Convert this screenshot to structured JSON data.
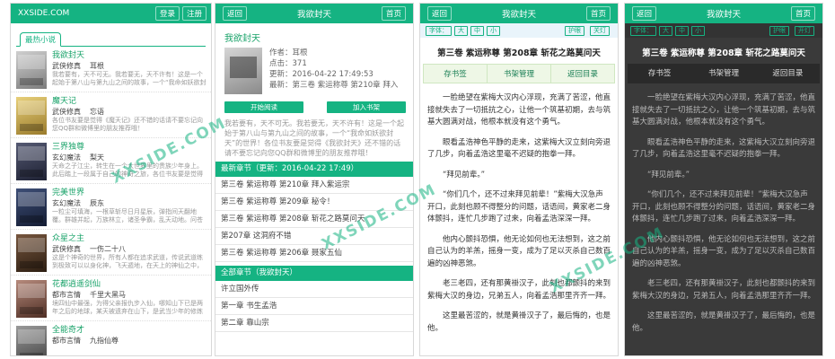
{
  "colors": {
    "accent": "#15b382",
    "link": "#1aa36a",
    "night_bg": "#3a3a3a"
  },
  "list_page": {
    "logo": "XXSIDE.COM",
    "login": "登录",
    "register": "注册",
    "section_tab": "最热小说",
    "books": [
      {
        "name": "我欲封天",
        "genre": "武侠修真",
        "author": "耳根",
        "desc": "我若要有，天不可无。我若要无，天不许有！这是一个起始于第八山与第九山之间的故事，一个“我命如妖欲封",
        "cover": [
          "#cfcfcf",
          "#7d7d7d"
        ]
      },
      {
        "name": "魔天记",
        "genre": "武侠修真",
        "author": "忘语",
        "desc": "各位书友要是觉得《魔天记》还不错的话请不要忘记向您QQ群和微博里的朋友推荐哦！",
        "cover": [
          "#e8d07a",
          "#9a7b2c"
        ]
      },
      {
        "name": "三界独尊",
        "genre": "玄幻魔法",
        "author": "梨天",
        "desc": "天命之子江尘，转生在一个大世界里的贵族少年身上。此后踏上一段属于自己的神奇之旅，各位书友要是觉得",
        "cover": [
          "#555a73",
          "#1e2133"
        ]
      },
      {
        "name": "完美世界",
        "genre": "玄幻魔法",
        "author": "辰东",
        "desc": "一粒尘可填海，一根草斩尽日月星辰，弹指间天翻地覆。群雄并起，万族林立，诸圣争霸，乱天动地。问苍茫大",
        "cover": [
          "#3e4f77",
          "#141c33"
        ]
      },
      {
        "name": "众星之主",
        "genre": "武侠修真",
        "author": "一伤二十八",
        "desc": "这是个神奇的世界，所有人都在追求武道，传说武道练到极致可以以身化神，飞天遁地，在天上的神仙之中，甚至",
        "cover": [
          "#77563e",
          "#2c1e12"
        ]
      },
      {
        "name": "花都逍遥剑仙",
        "genre": "都市言情",
        "author": "千里大黑马",
        "desc": "境四仙中最强，为得父亲报仇步入仙，哪知山下已是两年之后的地球，某天被遗弃在山下，是武当少年的修炼之路",
        "cover": [
          "#b68a7c",
          "#4f2f25"
        ]
      },
      {
        "name": "全能奇才",
        "genre": "都市言情",
        "author": "九指仙尊",
        "desc": "",
        "cover": [
          "#9a9a9a",
          "#444444"
        ]
      }
    ]
  },
  "detail_page": {
    "back": "返回",
    "title": "我欲封天",
    "home": "首页",
    "book_name": "我欲封天",
    "author": "作者：耳根",
    "clicks": "点击：371",
    "updated": "更新：2016-04-22 17:49:53",
    "latest_link": "最新：第三卷 紫运称尊 第210章 拜入",
    "read_button": "开始阅读",
    "shelf_button": "加入书架",
    "description": "我若要有，天不可无。我若要无，天不许有！这是一个起始于第八山与第九山之间的故事，一个“我命如妖欲封天”的世界！各位书友要是觉得《我欲封天》还不错的话请不要忘记向您QQ群和微博里的朋友推荐哦！",
    "latest_header": "最新章节（更新：2016-04-22 17:49）",
    "latest_chapters": [
      "第三卷 紫运称尊 第210章 拜入紫运宗",
      "第三卷 紫运称尊 第209章 秘令！",
      "第三卷 紫运称尊 第208章 斩花之路莫问天",
      "第207章 这洞府不错",
      "第三卷 紫运称尊 第206章 聂家五仙"
    ],
    "all_header": "全部章节（我欲封天）",
    "all_chapters": [
      "许立国外传",
      "第一章 书生孟浩",
      "第二章 靠山宗"
    ]
  },
  "reader_pages": [
    {
      "theme": "day",
      "back": "返回",
      "title": "我欲封天",
      "home": "首页",
      "font_label": "字体：",
      "font_large": "大",
      "font_medium": "中",
      "font_small": "小",
      "eye_mode": "护眼",
      "light_toggle": "关灯",
      "chapter_title": "第三卷 紫运称尊 第208章 斩花之路莫问天",
      "bookmark": "存书签",
      "manage": "书架管理",
      "toc": "返回目录",
      "paragraphs": [
        "一脸绝望在紫梅大汉内心浮现，充满了苦涩，他直接就失去了一切抵抗之心，让他一个筑基初期，去与筑基大圆满对战，他根本就没有这个勇气。",
        "眼看孟浩神色平静的走来，这紫梅大汉立刻向旁退了几步，向着孟浩这里毫不迟疑的抱拳一拜。",
        "“拜见前辈。”",
        "“你们几个，还不过来拜见前辈！”紫梅大汉急声开口，此刻也顾不得整分的问题，话语间，黄家老二身体颤抖，连忙几步跑了过来，向着孟浩深深一拜。",
        "他内心颤抖恐惧，他无论如何也无法想到，这之前自己认为的羊羔，摇身一变，成为了足以灭杀自己数百遍的凶神恶煞。",
        "老三老四，还有那黄褂汉子，此刻也都颤抖的来到紫梅大汉的身边，兄弟五人，向着孟浩那里齐齐一拜。",
        "这里最苦涩的，就是黄褂汉子了，最后悔的，也是他。"
      ]
    },
    {
      "theme": "night",
      "back": "返回",
      "title": "我欲封天",
      "home": "首页",
      "font_label": "字体：",
      "font_large": "大",
      "font_medium": "中",
      "font_small": "小",
      "eye_mode": "护眼",
      "light_toggle": "开灯",
      "chapter_title": "第三卷 紫运称尊 第208章 斩花之路莫问天",
      "bookmark": "存书签",
      "manage": "书架管理",
      "toc": "返回目录",
      "paragraphs": [
        "一脸绝望在紫梅大汉内心浮现，充满了苦涩，他直接就失去了一切抵抗之心，让他一个筑基初期，去与筑基大圆满对战，他根本就没有这个勇气。",
        "眼看孟浩神色平静的走来，这紫梅大汉立刻向旁退了几步，向着孟浩这里毫不迟疑的抱拳一拜。",
        "“拜见前辈。”",
        "“你们几个，还不过来拜见前辈！”紫梅大汉急声开口，此刻也顾不得整分的问题，话语间，黄家老二身体颤抖，连忙几步跑了过来，向着孟浩深深一拜。",
        "他内心颤抖恐惧，他无论如何也无法想到，这之前自己认为的羊羔，摇身一变，成为了足以灭杀自己数百遍的凶神恶煞。",
        "老三老四，还有那黄褂汉子，此刻也都颤抖的来到紫梅大汉的身边，兄弟五人，向着孟浩那里齐齐一拜。",
        "这里最苦涩的，就是黄褂汉子了，最后悔的，也是他。"
      ]
    }
  ],
  "watermark": "XXSIDE.COM"
}
